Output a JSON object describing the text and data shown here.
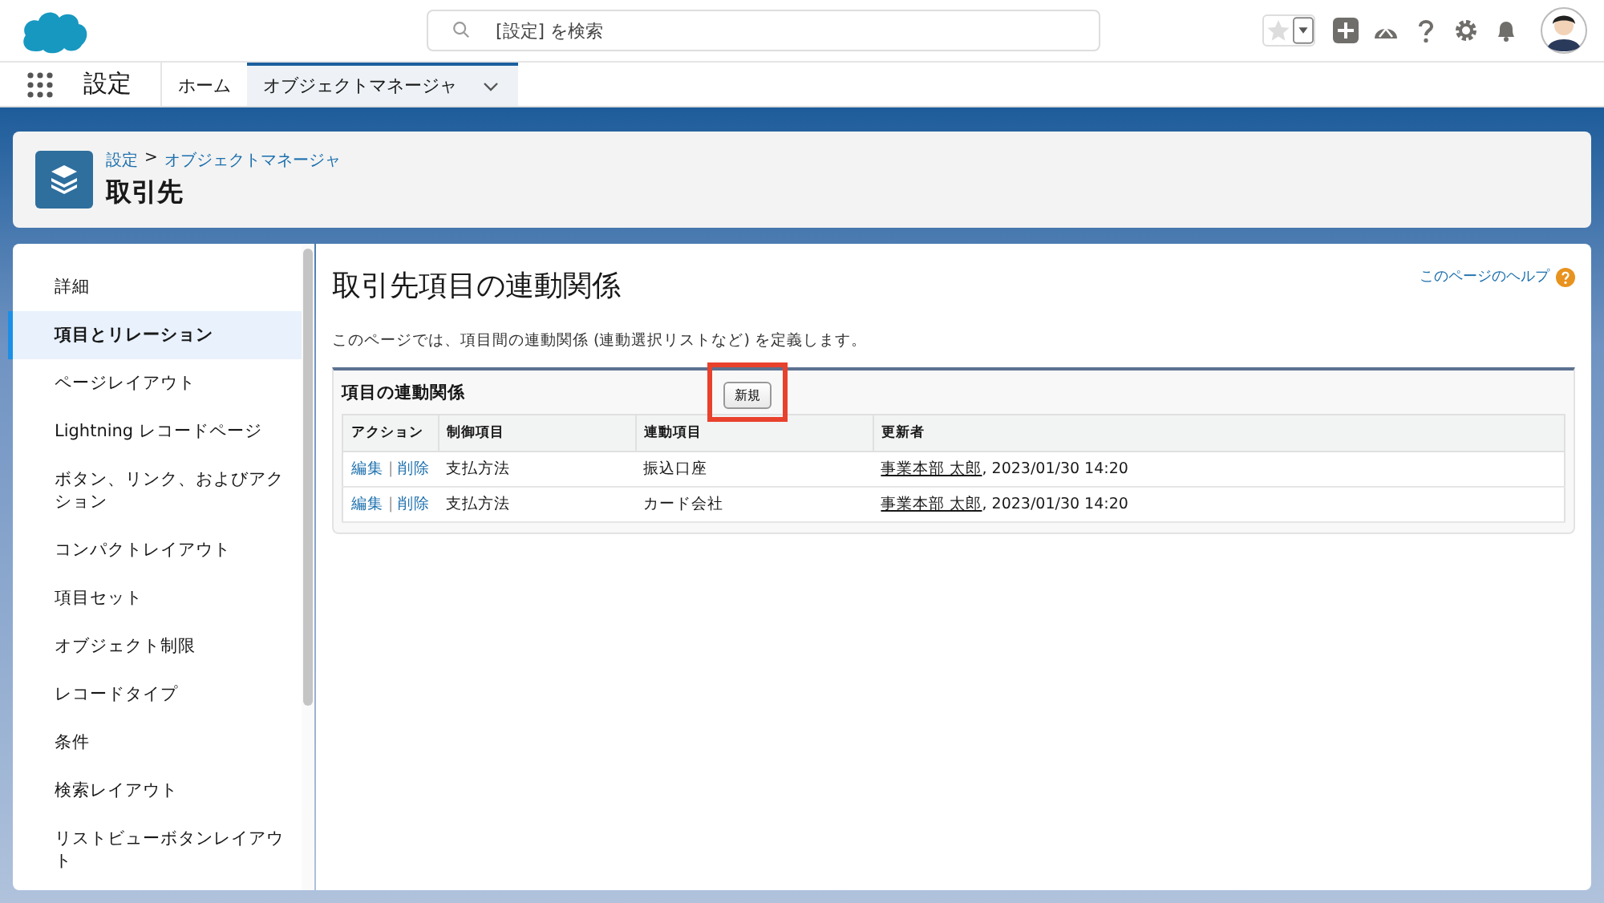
{
  "search": {
    "placeholder": "[設定] を検索"
  },
  "nav": {
    "app_name": "設定",
    "tabs": [
      {
        "label": "ホーム",
        "selected": false,
        "menu": false
      },
      {
        "label": "オブジェクトマネージャ",
        "selected": true,
        "menu": true
      }
    ]
  },
  "page_header": {
    "breadcrumb": [
      {
        "label": "設定",
        "kind": "link"
      },
      {
        "label": ">",
        "kind": "separator"
      },
      {
        "label": "オブジェクトマネージャ",
        "kind": "link"
      }
    ],
    "title": "取引先"
  },
  "sidebar": {
    "items": [
      {
        "label": "詳細",
        "selected": false
      },
      {
        "label": "項目とリレーション",
        "selected": true
      },
      {
        "label": "ページレイアウト",
        "selected": false
      },
      {
        "label": "Lightning レコードページ",
        "selected": false
      },
      {
        "label": "ボタン、リンク、およびアクション",
        "selected": false
      },
      {
        "label": "コンパクトレイアウト",
        "selected": false
      },
      {
        "label": "項目セット",
        "selected": false
      },
      {
        "label": "オブジェクト制限",
        "selected": false
      },
      {
        "label": "レコードタイプ",
        "selected": false
      },
      {
        "label": "条件",
        "selected": false
      },
      {
        "label": "検索レイアウト",
        "selected": false
      },
      {
        "label": "リストビューボタンレイアウト",
        "selected": false
      }
    ]
  },
  "main": {
    "title": "取引先項目の連動関係",
    "help_link": "このページのヘルプ",
    "description": "このページでは、項目間の連動関係 (連動選択リストなど) を定義します。",
    "section": {
      "title": "項目の連動関係",
      "new_button": {
        "label": "新規",
        "highlighted": true
      },
      "table": {
        "columns": [
          "アクション",
          "制御項目",
          "連動項目",
          "更新者"
        ],
        "rows": [
          {
            "edit": "編集",
            "separator": "|",
            "delete": "削除",
            "controlling": "支払方法",
            "dependent": "振込口座",
            "updated_by": "事業本部 太郎",
            "updated_at": ", 2023/01/30 14:20"
          },
          {
            "edit": "編集",
            "separator": "|",
            "delete": "削除",
            "controlling": "支払方法",
            "dependent": "カード会社",
            "updated_by": "事業本部 太郎",
            "updated_at": ", 2023/01/30 14:20"
          }
        ]
      }
    }
  }
}
